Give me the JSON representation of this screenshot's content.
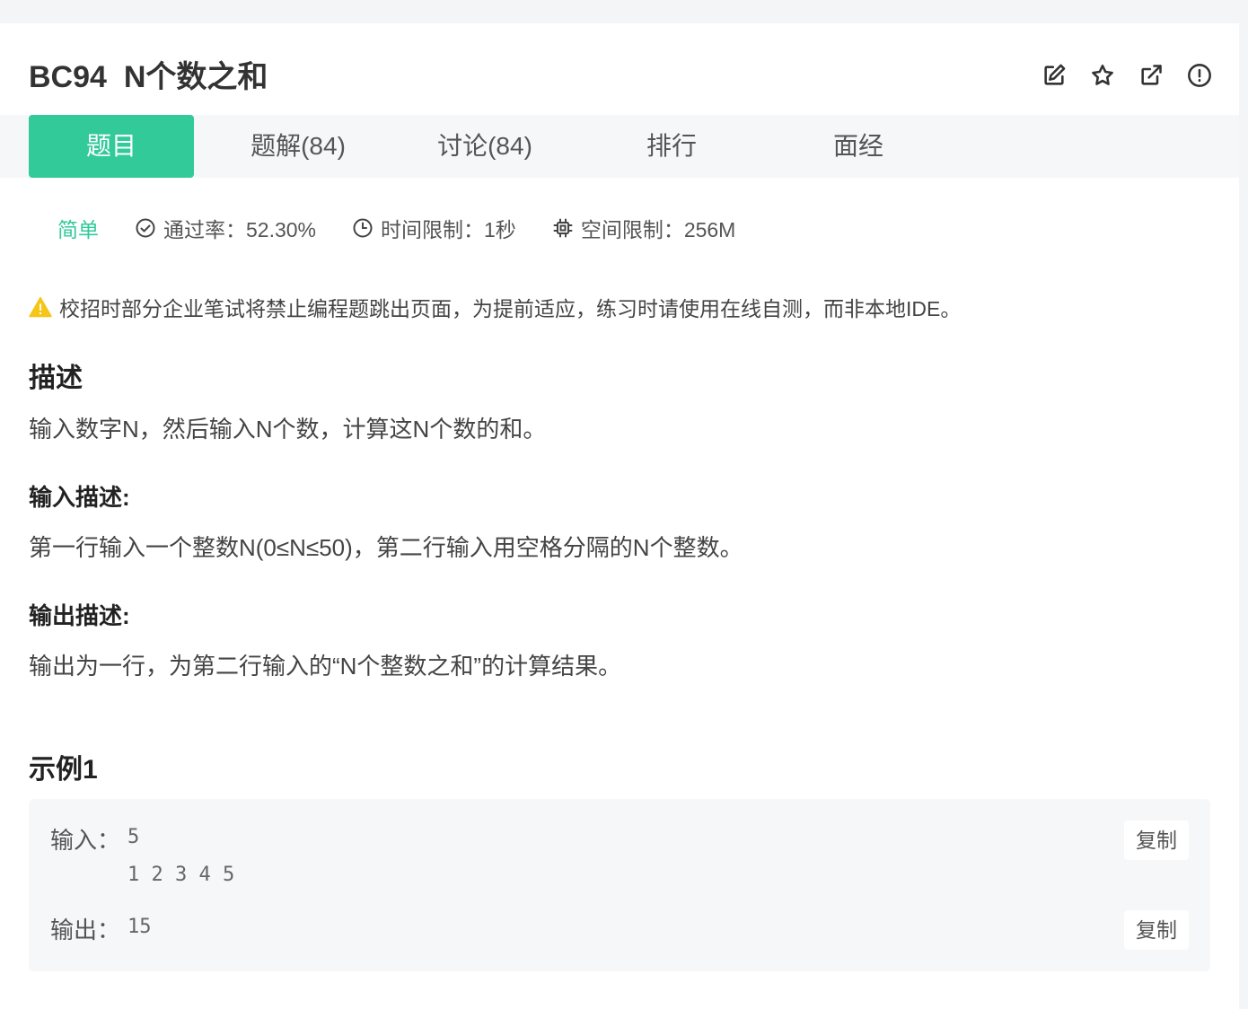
{
  "problem": {
    "title": "BC94  N个数之和"
  },
  "tabs": [
    {
      "label": "题目"
    },
    {
      "label": "题解(84)"
    },
    {
      "label": "讨论(84)"
    },
    {
      "label": "排行"
    },
    {
      "label": "面经"
    }
  ],
  "meta": {
    "level": "简单",
    "pass_rate": "通过率：52.30%",
    "time_limit": "时间限制：1秒",
    "space_limit": "空间限制：256M"
  },
  "notice": "校招时部分企业笔试将禁止编程题跳出页面，为提前适应，练习时请使用在线自测，而非本地IDE。",
  "description": {
    "heading": "描述",
    "text": "输入数字N，然后输入N个数，计算这N个数的和。"
  },
  "input_desc": {
    "heading": "输入描述:",
    "text": "第一行输入一个整数N(0≤N≤50)，第二行输入用空格分隔的N个整数。"
  },
  "output_desc": {
    "heading": "输出描述:",
    "text": "输出为一行，为第二行输入的“N个整数之和”的计算结果。"
  },
  "example": {
    "heading": "示例1",
    "input_label": "输入：",
    "input_line1": "5",
    "input_line2": "1 2 3 4 5",
    "output_label": "输出：",
    "output_value": "15",
    "copy_label": "复制"
  },
  "colors": {
    "accent": "#32ca99",
    "warning": "#f5c518"
  },
  "icons": [
    "edit-icon",
    "star-icon",
    "share-icon",
    "report-icon",
    "check-circle-icon",
    "clock-icon",
    "chip-icon",
    "warning-icon"
  ]
}
